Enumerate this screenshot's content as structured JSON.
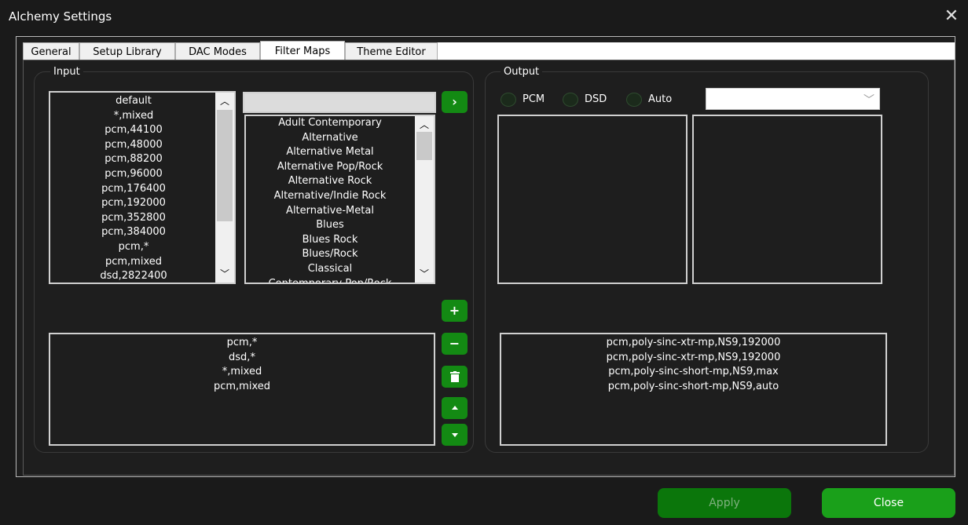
{
  "window": {
    "title": "Alchemy Settings",
    "close_glyph": "✕"
  },
  "tabs": [
    {
      "label": "General"
    },
    {
      "label": "Setup Library"
    },
    {
      "label": "DAC Modes"
    },
    {
      "label": "Filter Maps",
      "active": true
    },
    {
      "label": "Theme Editor"
    }
  ],
  "input": {
    "label": "Input",
    "formats": [
      "default",
      "*,mixed",
      "pcm,44100",
      "pcm,48000",
      "pcm,88200",
      "pcm,96000",
      "pcm,176400",
      "pcm,192000",
      "pcm,352800",
      "pcm,384000",
      "pcm,*",
      "pcm,mixed",
      "dsd,2822400"
    ],
    "genre_filter": "",
    "genres": [
      "Adult Contemporary",
      "Alternative",
      "Alternative Metal",
      "Alternative Pop/Rock",
      "Alternative Rock",
      "Alternative/Indie Rock",
      "Alternative-Metal",
      "Blues",
      "Blues Rock",
      "Blues/Rock",
      "Classical",
      "Contemporary Pop/Rock"
    ],
    "mapped": [
      "pcm,*",
      "dsd,*",
      "*,mixed",
      "pcm,mixed"
    ]
  },
  "output": {
    "label": "Output",
    "radios": [
      {
        "label": "PCM"
      },
      {
        "label": "DSD"
      },
      {
        "label": "Auto"
      }
    ],
    "combo_value": "",
    "mapped": [
      "pcm,poly-sinc-xtr-mp,NS9,192000",
      "pcm,poly-sinc-xtr-mp,NS9,192000",
      "pcm,poly-sinc-short-mp,NS9,max",
      "pcm,poly-sinc-short-mp,NS9,auto"
    ]
  },
  "buttons": {
    "transfer": "›",
    "add": "+",
    "remove": "−",
    "apply": "Apply",
    "close": "Close"
  },
  "icons": {
    "transfer": "chevron-right-icon",
    "add": "plus-icon",
    "remove": "minus-icon",
    "delete": "trash-icon",
    "up": "triangle-up-icon",
    "down": "triangle-down-icon"
  },
  "colors": {
    "button_green": "#138a13",
    "apply_green": "#0b760b",
    "apply_text": "#7fb07f",
    "close_green": "#1aa01a",
    "background": "#1e1e1e"
  }
}
